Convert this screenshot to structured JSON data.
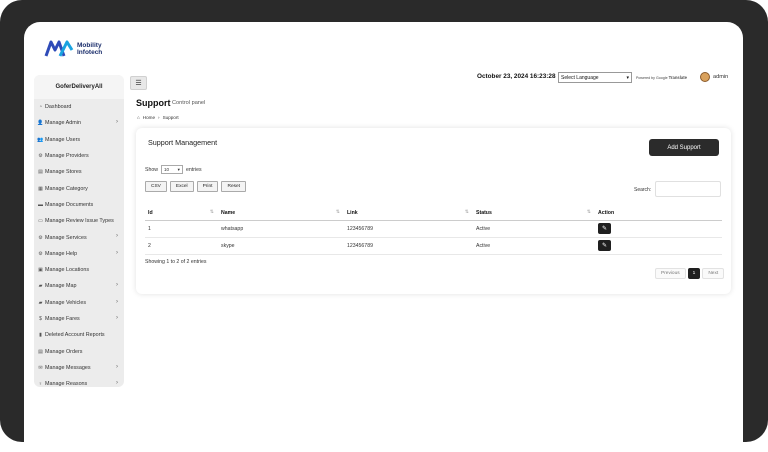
{
  "brand": {
    "line1": "Mobility",
    "line2": "Infotech"
  },
  "sidebar": {
    "title": "GoferDeliveryAll",
    "items": [
      {
        "label": "Dashboard",
        "icon": "gauge-icon",
        "glyph": "◔",
        "chevron": false
      },
      {
        "label": "Manage Admin",
        "icon": "user-plus-icon",
        "glyph": "👤",
        "chevron": true
      },
      {
        "label": "Manage Users",
        "icon": "users-icon",
        "glyph": "👥",
        "chevron": false
      },
      {
        "label": "Manage Providers",
        "icon": "providers-icon",
        "glyph": "⚙",
        "chevron": false
      },
      {
        "label": "Manage Stores",
        "icon": "store-icon",
        "glyph": "▤",
        "chevron": false
      },
      {
        "label": "Manage Category",
        "icon": "category-icon",
        "glyph": "▦",
        "chevron": false
      },
      {
        "label": "Manage Documents",
        "icon": "document-icon",
        "glyph": "▬",
        "chevron": false
      },
      {
        "label": "Manage Review Issue Types",
        "icon": "review-icon",
        "glyph": "▭",
        "chevron": false
      },
      {
        "label": "Manage Services",
        "icon": "services-icon",
        "glyph": "⚙",
        "chevron": true
      },
      {
        "label": "Manage Help",
        "icon": "help-icon",
        "glyph": "⚙",
        "chevron": true
      },
      {
        "label": "Manage Locations",
        "icon": "location-icon",
        "glyph": "▣",
        "chevron": false
      },
      {
        "label": "Manage Map",
        "icon": "car-icon",
        "glyph": "▰",
        "chevron": true
      },
      {
        "label": "Manage Vehicles",
        "icon": "vehicle-icon",
        "glyph": "▰",
        "chevron": true
      },
      {
        "label": "Manage Fares",
        "icon": "dollar-icon",
        "glyph": "$",
        "chevron": true
      },
      {
        "label": "Deleted Account Reports",
        "icon": "report-icon",
        "glyph": "▮",
        "chevron": false
      },
      {
        "label": "Manage Orders",
        "icon": "orders-icon",
        "glyph": "▤",
        "chevron": false
      },
      {
        "label": "Manage Messages",
        "icon": "envelope-icon",
        "glyph": "✉",
        "chevron": true
      },
      {
        "label": "Manage Reasons",
        "icon": "bulb-icon",
        "glyph": "♀",
        "chevron": true
      }
    ]
  },
  "topbar": {
    "datetime": "October 23, 2024 16:23:28",
    "language_select": "Select Language",
    "powered_by": "Powered by",
    "google": "Google",
    "translate": "Translate",
    "user": "admin"
  },
  "page": {
    "title": "Support",
    "subtitle": "Control panel",
    "breadcrumb": [
      "Home",
      "Support"
    ]
  },
  "card": {
    "title": "Support Management",
    "add_button": "Add Support",
    "show_label": "Show",
    "page_length": "10",
    "entries_label": "entries",
    "export_buttons": [
      "CSV",
      "Excel",
      "Print",
      "Reset"
    ],
    "search_label": "Search:",
    "columns": [
      "Id",
      "Name",
      "Link",
      "Status",
      "Action"
    ],
    "rows": [
      {
        "id": "1",
        "name": "whatsapp",
        "link": "123456789",
        "status": "Active"
      },
      {
        "id": "2",
        "name": "skype",
        "link": "123456789",
        "status": "Active"
      }
    ],
    "info": "Showing 1 to 2 of 2 entries",
    "pagination": {
      "previous": "Previous",
      "current": "1",
      "next": "Next"
    }
  }
}
